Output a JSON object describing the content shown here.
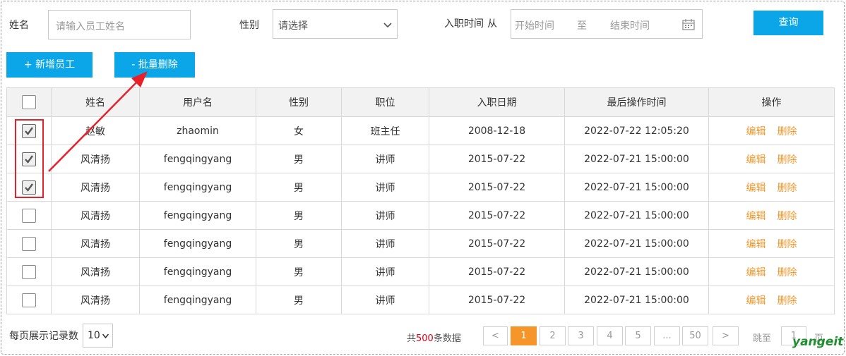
{
  "search": {
    "name_label": "姓名",
    "name_placeholder": "请输入员工姓名",
    "gender_label": "性别",
    "gender_value": "请选择",
    "date_label": "入职时间",
    "date_from_label": "从",
    "date_start_placeholder": "开始时间",
    "date_to_label": "至",
    "date_end_placeholder": "结束时间",
    "query_button": "查询"
  },
  "toolbar": {
    "add_button": "+ 新增员工",
    "batch_delete_button": "- 批量删除"
  },
  "table": {
    "columns": [
      "姓名",
      "用户名",
      "性别",
      "职位",
      "入职日期",
      "最后操作时间",
      "操作"
    ],
    "action_edit": "编辑",
    "action_delete": "删除",
    "rows": [
      {
        "checked": true,
        "name": "赵敏",
        "username": "zhaomin",
        "gender": "女",
        "position": "班主任",
        "hire_date": "2008-12-18",
        "last_op": "2022-07-22 12:05:20"
      },
      {
        "checked": true,
        "name": "风清扬",
        "username": "fengqingyang",
        "gender": "男",
        "position": "讲师",
        "hire_date": "2015-07-22",
        "last_op": "2022-07-21 15:00:00"
      },
      {
        "checked": true,
        "name": "风清扬",
        "username": "fengqingyang",
        "gender": "男",
        "position": "讲师",
        "hire_date": "2015-07-22",
        "last_op": "2022-07-21 15:00:00"
      },
      {
        "checked": false,
        "name": "风清扬",
        "username": "fengqingyang",
        "gender": "男",
        "position": "讲师",
        "hire_date": "2015-07-22",
        "last_op": "2022-07-21 15:00:00"
      },
      {
        "checked": false,
        "name": "风清扬",
        "username": "fengqingyang",
        "gender": "男",
        "position": "讲师",
        "hire_date": "2015-07-22",
        "last_op": "2022-07-21 15:00:00"
      },
      {
        "checked": false,
        "name": "风清扬",
        "username": "fengqingyang",
        "gender": "男",
        "position": "讲师",
        "hire_date": "2015-07-22",
        "last_op": "2022-07-21 15:00:00"
      },
      {
        "checked": false,
        "name": "风清扬",
        "username": "fengqingyang",
        "gender": "男",
        "position": "讲师",
        "hire_date": "2015-07-22",
        "last_op": "2022-07-21 15:00:00"
      }
    ]
  },
  "footer": {
    "per_page_label": "每页展示记录数",
    "per_page_value": "10",
    "total_prefix": "共",
    "total_count": "500",
    "total_suffix": "条数据",
    "prev": "<",
    "pages": [
      "1",
      "2",
      "3",
      "4",
      "5",
      "...",
      "50"
    ],
    "current_page": "1",
    "next": ">",
    "jump_label": "跳至",
    "jump_value": "1",
    "jump_suffix": "页"
  },
  "watermark": "yangeit",
  "colors": {
    "primary": "#0aa6e8",
    "action": "#f6962a",
    "annotation": "#e8202a",
    "total_count": "#d9001b"
  }
}
